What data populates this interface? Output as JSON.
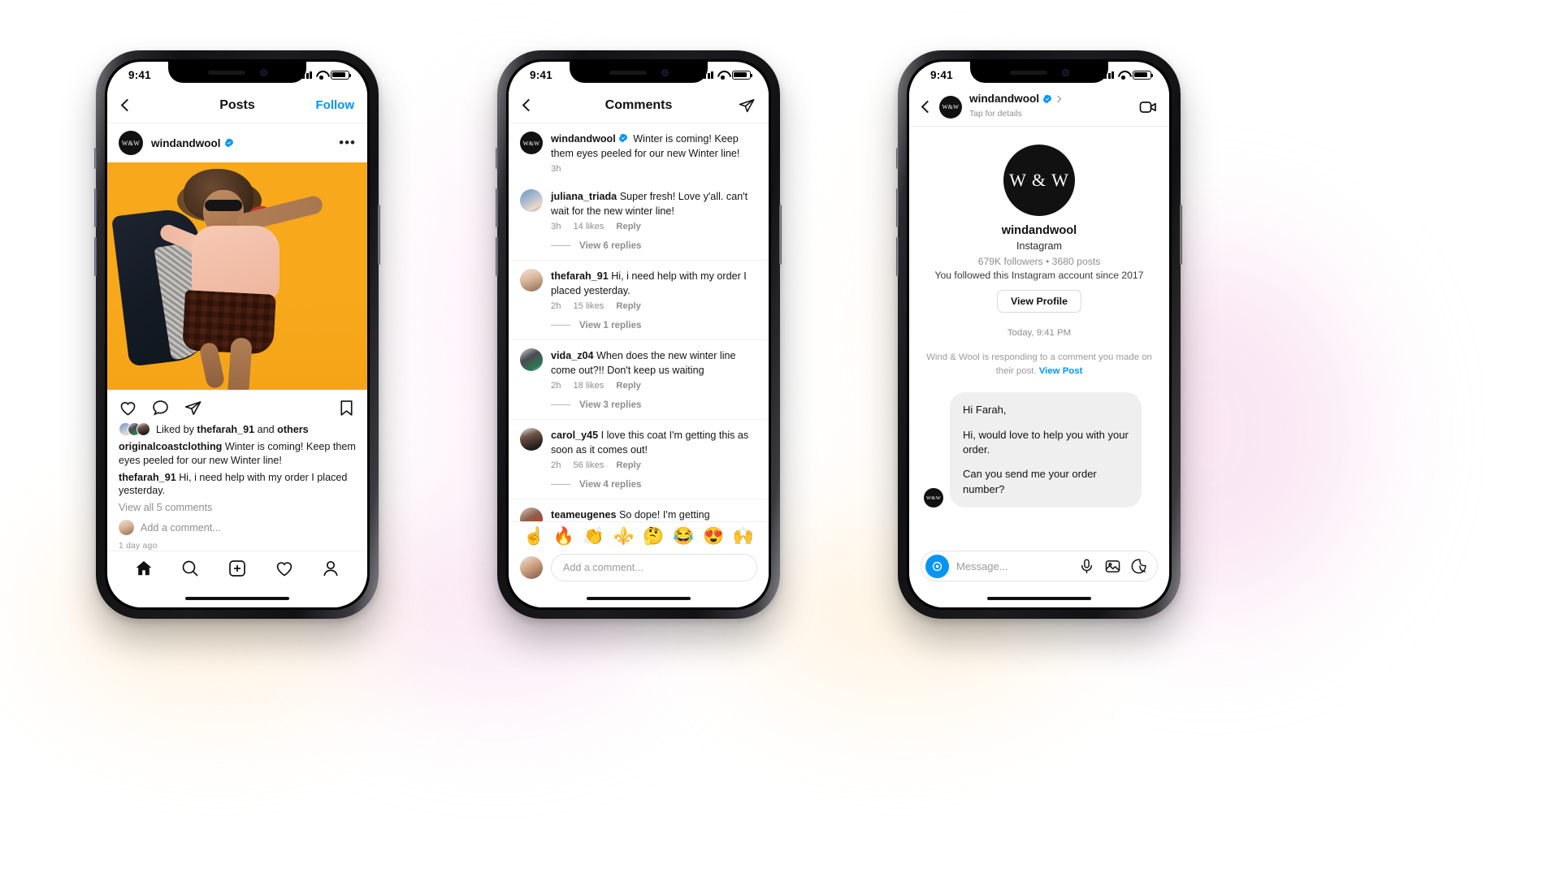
{
  "statusbar": {
    "time": "9:41"
  },
  "brand": {
    "avatar_text": "W&W",
    "accent": "#0095f6",
    "verified_color": "#0095f6"
  },
  "phone1": {
    "nav": {
      "back_icon": "chevron-left-icon",
      "title": "Posts",
      "action": "Follow"
    },
    "post": {
      "username": "windandwool",
      "verified": true,
      "more_icon": "more-options-icon",
      "actions": [
        "heart-icon",
        "comment-icon",
        "share-icon",
        "bookmark-icon"
      ],
      "likes_prefix": "Liked by ",
      "likes_user": "thefarah_91",
      "likes_mid": " and ",
      "likes_suffix": "others",
      "caption_user": "originalcoastclothing",
      "caption_text": " Winter is coming! Keep them eyes peeled for our new Winter line!",
      "comment_user": "thefarah_91",
      "comment_text": "  Hi, i need help with my order I placed yesterday.",
      "view_all": "View all 5 comments",
      "add_comment": "Add a comment...",
      "timestamp": "1 day ago"
    },
    "tabbar": [
      "home-icon",
      "search-icon",
      "add-post-icon",
      "activity-icon",
      "profile-icon"
    ]
  },
  "phone2": {
    "nav": {
      "back_icon": "chevron-left-icon",
      "title": "Comments",
      "send_icon": "share-icon"
    },
    "comments": [
      {
        "avatar": "ww",
        "username": "windandwool",
        "verified": true,
        "text": " Winter is coming! Keep them eyes peeled for our new Winter line!",
        "time": "3h",
        "likes": "",
        "reply": "",
        "replies_link": ""
      },
      {
        "avatar": "p1",
        "username": "juliana_triada",
        "verified": false,
        "text": " Super fresh! Love y'all. can't wait for the new winter line!",
        "time": "3h",
        "likes": "14 likes",
        "reply": "Reply",
        "replies_link": "View 6 replies"
      },
      {
        "avatar": "p2",
        "username": "thefarah_91",
        "verified": false,
        "text": "  Hi, i need help with my order I placed yesterday.",
        "time": "2h",
        "likes": "15 likes",
        "reply": "Reply",
        "replies_link": "View 1 replies"
      },
      {
        "avatar": "p3",
        "username": "vida_z04",
        "verified": false,
        "text": "  When does the new winter line come out?!! Don't keep us waiting",
        "time": "2h",
        "likes": "18 likes",
        "reply": "Reply",
        "replies_link": "View 3 replies"
      },
      {
        "avatar": "p4",
        "username": "carol_y45",
        "verified": false,
        "text": "  I love this coat I'm getting this as soon as it comes out!",
        "time": "2h",
        "likes": "56 likes",
        "reply": "Reply",
        "replies_link": "View 4 replies"
      },
      {
        "avatar": "p5",
        "username": "teameugenes",
        "verified": false,
        "text": "  So dope! I'm getting",
        "time": "",
        "likes": "",
        "reply": "",
        "replies_link": ""
      }
    ],
    "emojis": [
      "☝️",
      "🔥",
      "👏",
      "⚜️",
      "🤔",
      "😂",
      "😍",
      "🙌"
    ],
    "input": {
      "placeholder": "Add a comment..."
    }
  },
  "phone3": {
    "nav": {
      "back_icon": "chevron-left-icon",
      "name": "windandwool",
      "verified": true,
      "chevron": "chevron-right-icon",
      "subtitle": "Tap for details",
      "video_icon": "video-call-icon"
    },
    "profile": {
      "avatar_text": "W & W",
      "name": "windandwool",
      "platform": "Instagram",
      "stats": "679K followers • 3680 posts",
      "since": "You followed this Instagram account since 2017",
      "view_profile": "View Profile"
    },
    "thread": {
      "time": "Today, 9:41 PM",
      "note_text": "Wind & Wool is responding to a comment you made on their post. ",
      "note_link": "View Post",
      "message_lines": [
        "Hi Farah,",
        "Hi, would love to help you with your order.",
        "Can you send me your order number?"
      ]
    },
    "input": {
      "camera_icon": "camera-icon",
      "placeholder": "Message...",
      "actions": [
        "microphone-icon",
        "photo-icon",
        "sticker-icon"
      ]
    }
  }
}
